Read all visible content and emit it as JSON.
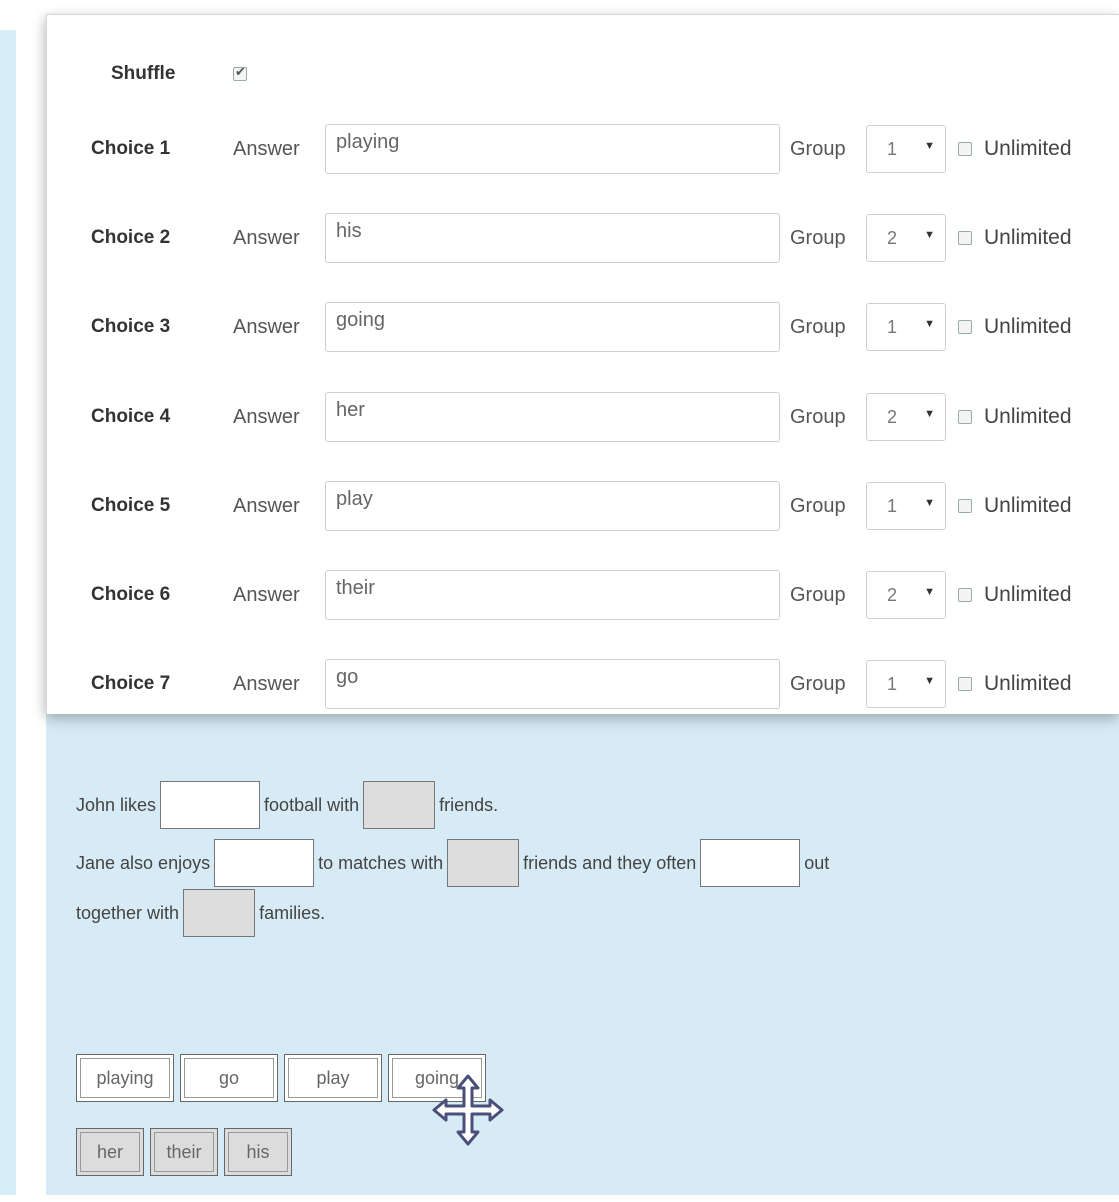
{
  "settings": {
    "shuffle_label": "Shuffle",
    "shuffle_checked": true
  },
  "choices": [
    {
      "label": "Choice 1",
      "answer_label": "Answer",
      "answer": "playing",
      "group_label": "Group",
      "group": "1",
      "unlimited_label": "Unlimited",
      "unlimited": false
    },
    {
      "label": "Choice 2",
      "answer_label": "Answer",
      "answer": "his",
      "group_label": "Group",
      "group": "2",
      "unlimited_label": "Unlimited",
      "unlimited": false
    },
    {
      "label": "Choice 3",
      "answer_label": "Answer",
      "answer": "going",
      "group_label": "Group",
      "group": "1",
      "unlimited_label": "Unlimited",
      "unlimited": false
    },
    {
      "label": "Choice 4",
      "answer_label": "Answer",
      "answer": "her",
      "group_label": "Group",
      "group": "2",
      "unlimited_label": "Unlimited",
      "unlimited": false
    },
    {
      "label": "Choice 5",
      "answer_label": "Answer",
      "answer": "play",
      "group_label": "Group",
      "group": "1",
      "unlimited_label": "Unlimited",
      "unlimited": false
    },
    {
      "label": "Choice 6",
      "answer_label": "Answer",
      "answer": "their",
      "group_label": "Group",
      "group": "2",
      "unlimited_label": "Unlimited",
      "unlimited": false
    },
    {
      "label": "Choice 7",
      "answer_label": "Answer",
      "answer": "go",
      "group_label": "Group",
      "group": "1",
      "unlimited_label": "Unlimited",
      "unlimited": false
    }
  ],
  "question": {
    "line1": {
      "t1": "John likes",
      "t2": "football with",
      "t3": "friends."
    },
    "line2": {
      "t1": "Jane also enjoys",
      "t2": "to matches with",
      "t3": "friends and they often",
      "t4": "out"
    },
    "line3": {
      "t1": "together with",
      "t2": "families."
    }
  },
  "tiles": {
    "group1": [
      "playing",
      "go",
      "play",
      "going"
    ],
    "group2": [
      "her",
      "their",
      "his"
    ]
  },
  "icons": {
    "cursor": "move-cursor-icon",
    "caret": "caret-down-icon"
  }
}
